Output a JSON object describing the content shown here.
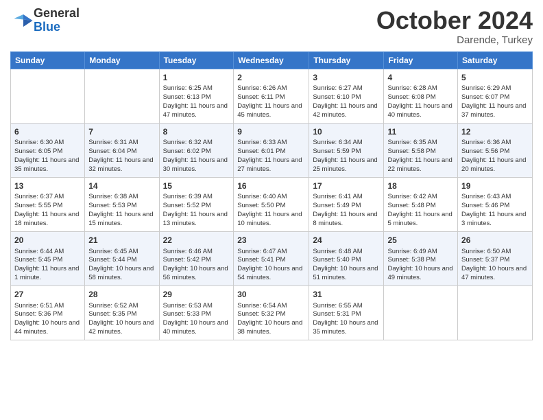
{
  "header": {
    "logo": {
      "general": "General",
      "blue": "Blue"
    },
    "title": "October 2024",
    "location": "Darende, Turkey"
  },
  "weekdays": [
    "Sunday",
    "Monday",
    "Tuesday",
    "Wednesday",
    "Thursday",
    "Friday",
    "Saturday"
  ],
  "weeks": [
    [
      {
        "day": "",
        "info": ""
      },
      {
        "day": "",
        "info": ""
      },
      {
        "day": "1",
        "info": "Sunrise: 6:25 AM\nSunset: 6:13 PM\nDaylight: 11 hours and 47 minutes."
      },
      {
        "day": "2",
        "info": "Sunrise: 6:26 AM\nSunset: 6:11 PM\nDaylight: 11 hours and 45 minutes."
      },
      {
        "day": "3",
        "info": "Sunrise: 6:27 AM\nSunset: 6:10 PM\nDaylight: 11 hours and 42 minutes."
      },
      {
        "day": "4",
        "info": "Sunrise: 6:28 AM\nSunset: 6:08 PM\nDaylight: 11 hours and 40 minutes."
      },
      {
        "day": "5",
        "info": "Sunrise: 6:29 AM\nSunset: 6:07 PM\nDaylight: 11 hours and 37 minutes."
      }
    ],
    [
      {
        "day": "6",
        "info": "Sunrise: 6:30 AM\nSunset: 6:05 PM\nDaylight: 11 hours and 35 minutes."
      },
      {
        "day": "7",
        "info": "Sunrise: 6:31 AM\nSunset: 6:04 PM\nDaylight: 11 hours and 32 minutes."
      },
      {
        "day": "8",
        "info": "Sunrise: 6:32 AM\nSunset: 6:02 PM\nDaylight: 11 hours and 30 minutes."
      },
      {
        "day": "9",
        "info": "Sunrise: 6:33 AM\nSunset: 6:01 PM\nDaylight: 11 hours and 27 minutes."
      },
      {
        "day": "10",
        "info": "Sunrise: 6:34 AM\nSunset: 5:59 PM\nDaylight: 11 hours and 25 minutes."
      },
      {
        "day": "11",
        "info": "Sunrise: 6:35 AM\nSunset: 5:58 PM\nDaylight: 11 hours and 22 minutes."
      },
      {
        "day": "12",
        "info": "Sunrise: 6:36 AM\nSunset: 5:56 PM\nDaylight: 11 hours and 20 minutes."
      }
    ],
    [
      {
        "day": "13",
        "info": "Sunrise: 6:37 AM\nSunset: 5:55 PM\nDaylight: 11 hours and 18 minutes."
      },
      {
        "day": "14",
        "info": "Sunrise: 6:38 AM\nSunset: 5:53 PM\nDaylight: 11 hours and 15 minutes."
      },
      {
        "day": "15",
        "info": "Sunrise: 6:39 AM\nSunset: 5:52 PM\nDaylight: 11 hours and 13 minutes."
      },
      {
        "day": "16",
        "info": "Sunrise: 6:40 AM\nSunset: 5:50 PM\nDaylight: 11 hours and 10 minutes."
      },
      {
        "day": "17",
        "info": "Sunrise: 6:41 AM\nSunset: 5:49 PM\nDaylight: 11 hours and 8 minutes."
      },
      {
        "day": "18",
        "info": "Sunrise: 6:42 AM\nSunset: 5:48 PM\nDaylight: 11 hours and 5 minutes."
      },
      {
        "day": "19",
        "info": "Sunrise: 6:43 AM\nSunset: 5:46 PM\nDaylight: 11 hours and 3 minutes."
      }
    ],
    [
      {
        "day": "20",
        "info": "Sunrise: 6:44 AM\nSunset: 5:45 PM\nDaylight: 11 hours and 1 minute."
      },
      {
        "day": "21",
        "info": "Sunrise: 6:45 AM\nSunset: 5:44 PM\nDaylight: 10 hours and 58 minutes."
      },
      {
        "day": "22",
        "info": "Sunrise: 6:46 AM\nSunset: 5:42 PM\nDaylight: 10 hours and 56 minutes."
      },
      {
        "day": "23",
        "info": "Sunrise: 6:47 AM\nSunset: 5:41 PM\nDaylight: 10 hours and 54 minutes."
      },
      {
        "day": "24",
        "info": "Sunrise: 6:48 AM\nSunset: 5:40 PM\nDaylight: 10 hours and 51 minutes."
      },
      {
        "day": "25",
        "info": "Sunrise: 6:49 AM\nSunset: 5:38 PM\nDaylight: 10 hours and 49 minutes."
      },
      {
        "day": "26",
        "info": "Sunrise: 6:50 AM\nSunset: 5:37 PM\nDaylight: 10 hours and 47 minutes."
      }
    ],
    [
      {
        "day": "27",
        "info": "Sunrise: 6:51 AM\nSunset: 5:36 PM\nDaylight: 10 hours and 44 minutes."
      },
      {
        "day": "28",
        "info": "Sunrise: 6:52 AM\nSunset: 5:35 PM\nDaylight: 10 hours and 42 minutes."
      },
      {
        "day": "29",
        "info": "Sunrise: 6:53 AM\nSunset: 5:33 PM\nDaylight: 10 hours and 40 minutes."
      },
      {
        "day": "30",
        "info": "Sunrise: 6:54 AM\nSunset: 5:32 PM\nDaylight: 10 hours and 38 minutes."
      },
      {
        "day": "31",
        "info": "Sunrise: 6:55 AM\nSunset: 5:31 PM\nDaylight: 10 hours and 35 minutes."
      },
      {
        "day": "",
        "info": ""
      },
      {
        "day": "",
        "info": ""
      }
    ]
  ]
}
